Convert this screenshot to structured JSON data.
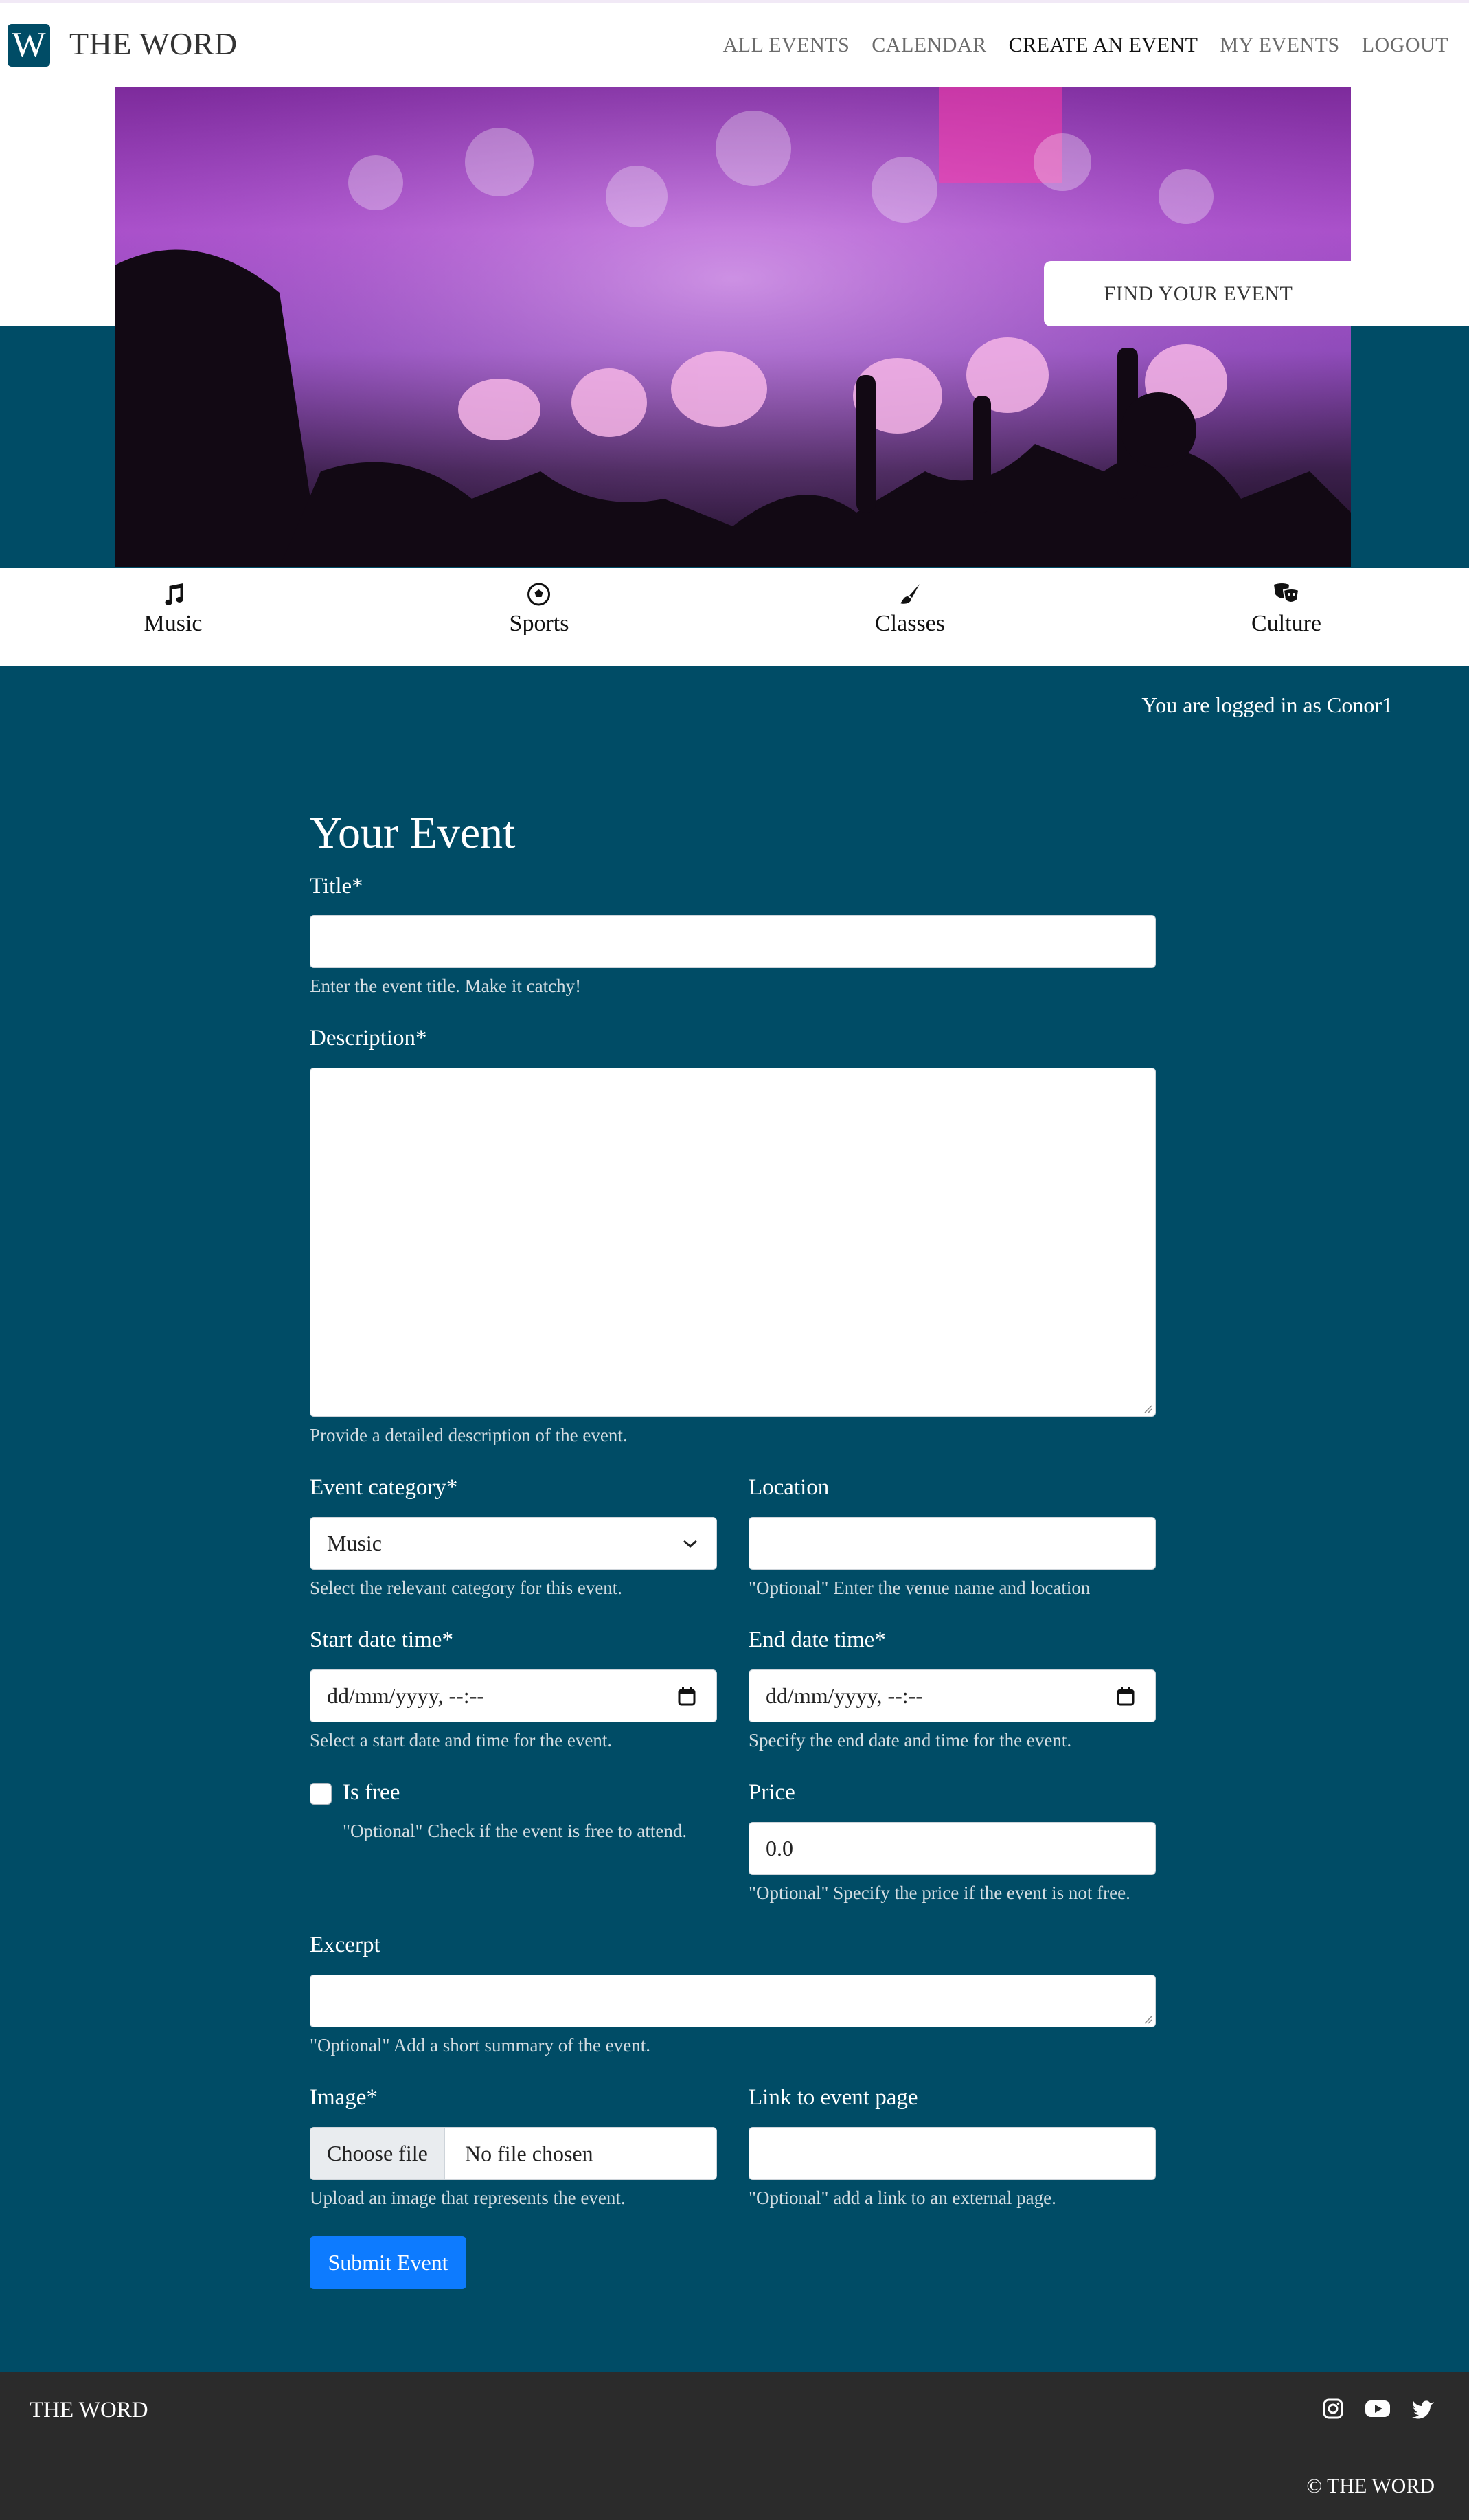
{
  "brand": {
    "logo_letter": "W",
    "name": "THE WORD"
  },
  "nav": {
    "links": [
      {
        "label": "ALL EVENTS"
      },
      {
        "label": "CALENDAR"
      },
      {
        "label": "CREATE AN EVENT",
        "active": true
      },
      {
        "label": "MY EVENTS"
      },
      {
        "label": "LOGOUT"
      }
    ]
  },
  "hero": {
    "find_button": "FIND YOUR EVENT"
  },
  "categories": [
    {
      "label": "Music",
      "icon": "music-note-icon"
    },
    {
      "label": "Sports",
      "icon": "soccer-ball-icon"
    },
    {
      "label": "Classes",
      "icon": "paintbrush-icon"
    },
    {
      "label": "Culture",
      "icon": "theater-masks-icon"
    }
  ],
  "session": {
    "logged_in_text": "You are logged in as Conor1"
  },
  "form": {
    "heading": "Your Event",
    "title": {
      "label": "Title*",
      "value": "",
      "help": "Enter the event title. Make it catchy!"
    },
    "description": {
      "label": "Description*",
      "value": "",
      "help": "Provide a detailed description of the event."
    },
    "category": {
      "label": "Event category*",
      "value": "Music",
      "help": "Select the relevant category for this event."
    },
    "location": {
      "label": "Location",
      "value": "",
      "help": "\"Optional\" Enter the venue name and location"
    },
    "start": {
      "label": "Start date time*",
      "placeholder": "dd/mm/yyyy, --:--",
      "help": "Select a start date and time for the event."
    },
    "end": {
      "label": "End date time*",
      "placeholder": "dd/mm/yyyy, --:--",
      "help": "Specify the end date and time for the event."
    },
    "is_free": {
      "label": "Is free",
      "checked": false,
      "help": "\"Optional\" Check if the event is free to attend."
    },
    "price": {
      "label": "Price",
      "value": "0.0",
      "help": "\"Optional\" Specify the price if the event is not free."
    },
    "excerpt": {
      "label": "Excerpt",
      "value": "",
      "help": "\"Optional\" Add a short summary of the event."
    },
    "image": {
      "label": "Image*",
      "button": "Choose file",
      "status": "No file chosen",
      "help": "Upload an image that represents the event."
    },
    "link": {
      "label": "Link to event page",
      "value": "",
      "help": "\"Optional\" add a link to an external page."
    },
    "submit": "Submit Event"
  },
  "footer": {
    "brand": "THE WORD",
    "social": [
      "instagram-icon",
      "youtube-icon",
      "twitter-icon"
    ],
    "copyright": "© THE WORD"
  },
  "colors": {
    "primary_teal": "#004c66",
    "submit_blue": "#0d7bff",
    "footer_bg": "#2b2b2b"
  }
}
